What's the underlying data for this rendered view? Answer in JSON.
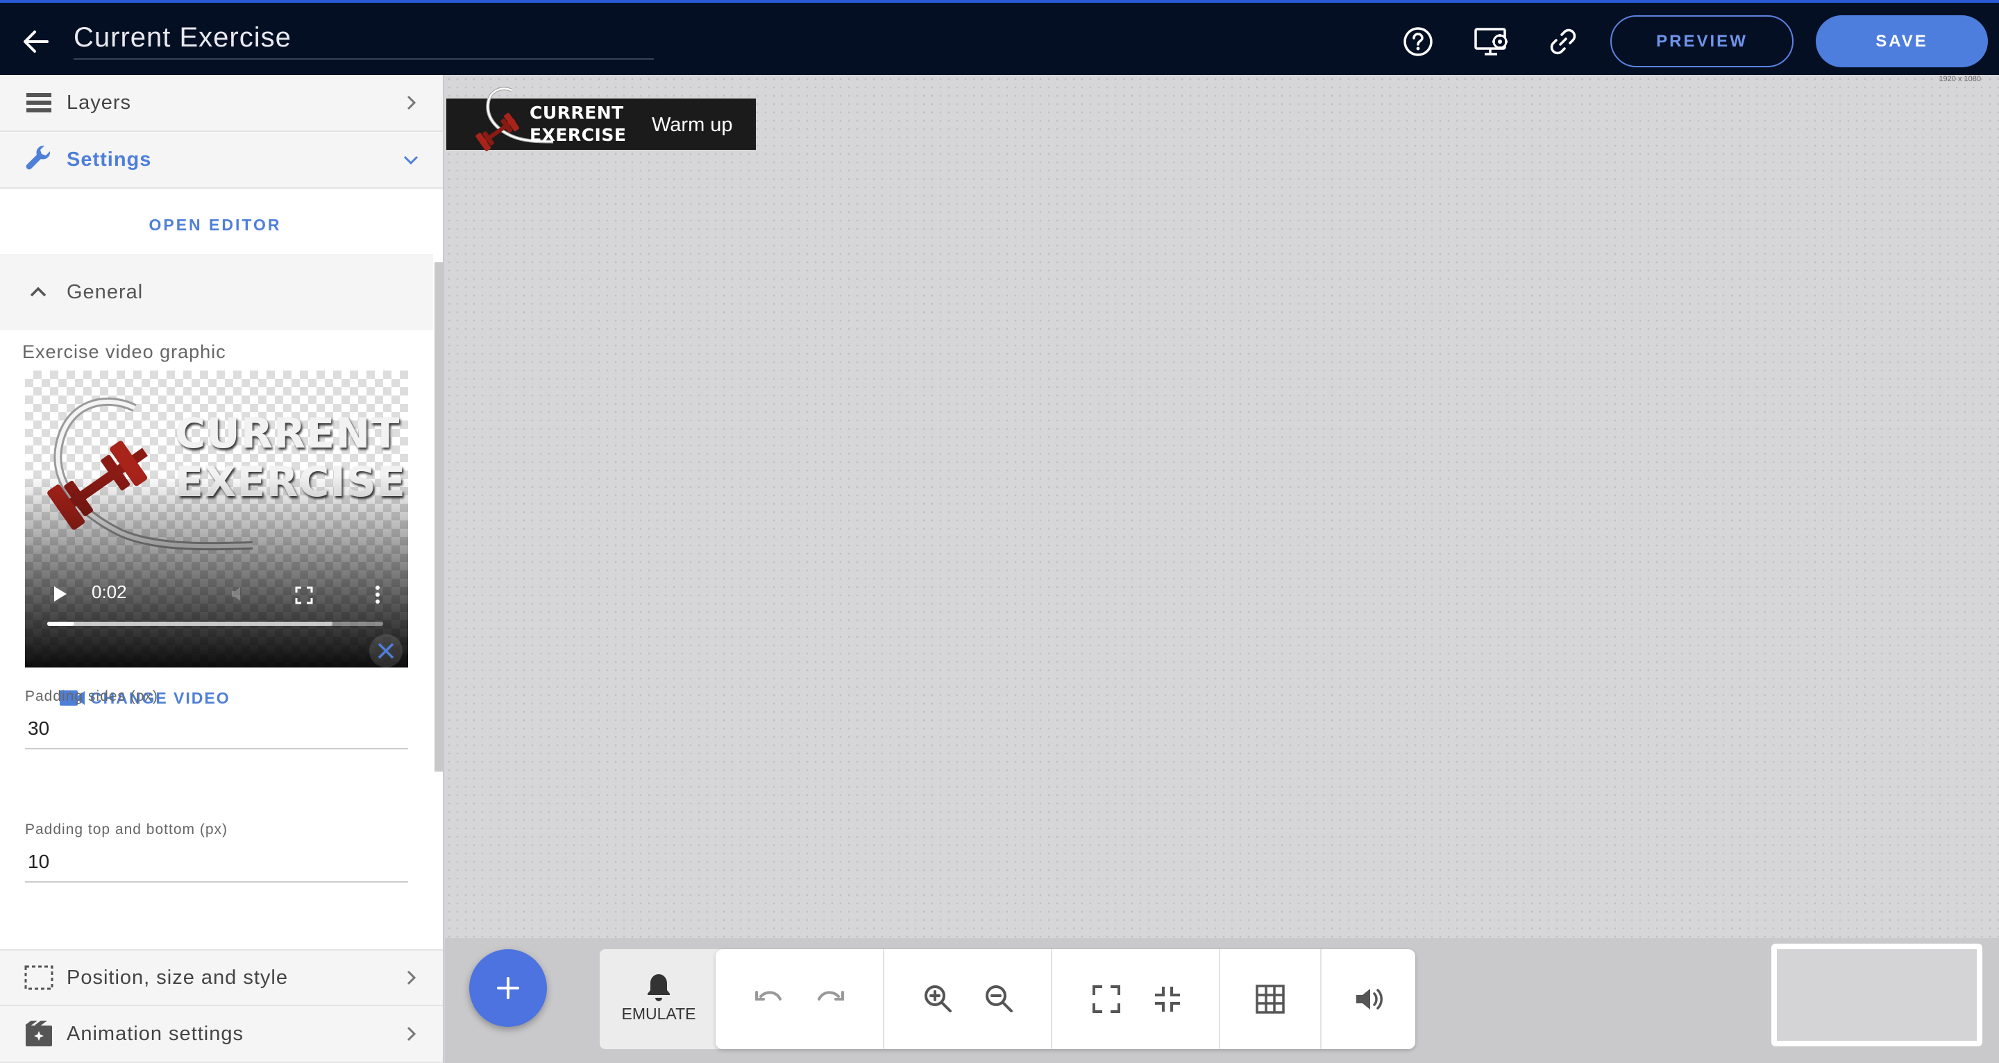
{
  "header": {
    "title": "Current Exercise",
    "preview_label": "PREVIEW",
    "save_label": "SAVE"
  },
  "sidebar": {
    "layers_label": "Layers",
    "settings_label": "Settings",
    "open_editor_label": "OPEN EDITOR",
    "general_label": "General",
    "video_label": "Exercise video graphic",
    "video_time": "0:02",
    "video_progress": 0.08,
    "video_buffered": 0.85,
    "video_thumbnail_text": [
      "CURRENT",
      "EXERCISE"
    ],
    "change_video_label": "CHANGE VIDEO",
    "padding_sides_label": "Padding sides (px)",
    "padding_sides_value": "30",
    "padding_tb_label": "Padding top and bottom (px)",
    "padding_tb_value": "10",
    "position_label": "Position, size and style",
    "animation_label": "Animation settings"
  },
  "canvas": {
    "resolution_label": "1920 x 1080",
    "lower_third": {
      "line1": "CURRENT",
      "line2": "EXERCISE",
      "subtitle": "Warm up"
    }
  },
  "bottom_toolbar": {
    "emulate_label": "EMULATE"
  },
  "colors": {
    "accent": "#4e7fd9",
    "topbar_bg": "#050f24",
    "save_bg": "#4d7ede",
    "fab_bg": "#4c73e0"
  }
}
